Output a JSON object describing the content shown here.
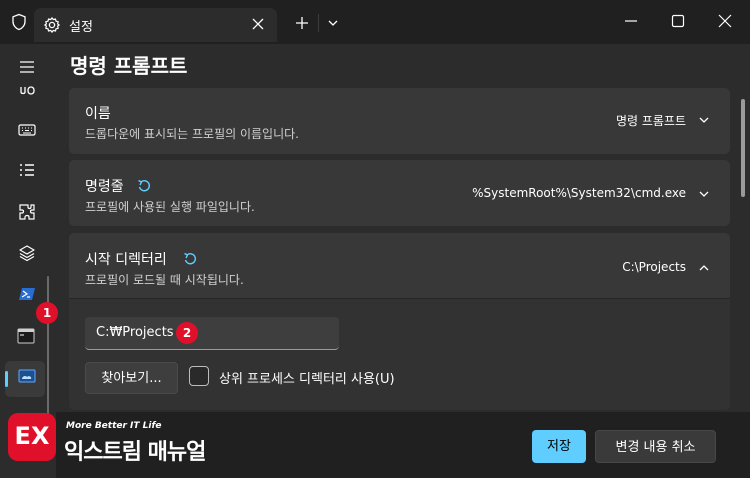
{
  "window": {
    "tab_title": "설정"
  },
  "page": {
    "title": "명령 프롬프트"
  },
  "settings": {
    "name": {
      "title": "이름",
      "desc": "드롭다운에 표시되는 프로필의 이름입니다.",
      "value": "명령 프롬프트"
    },
    "commandline": {
      "title": "명령줄",
      "desc": "프로필에 사용된 실행 파일입니다.",
      "value": "%SystemRoot%\\System32\\cmd.exe"
    },
    "start_dir": {
      "title": "시작 디렉터리",
      "desc": "프로필이 로드될 때 시작됩니다.",
      "value": "C:\\Projects",
      "input_value": "C:₩Projects",
      "browse_label": "찾아보기...",
      "checkbox_label": "상위 프로세스 디렉터리 사용(U)",
      "checkbox_checked": false
    }
  },
  "footer": {
    "save_label": "저장",
    "discard_label": "변경 내용 취소"
  },
  "badges": {
    "one": "1",
    "two": "2"
  },
  "watermark": {
    "logo": "EX",
    "tagline": "More Better IT Life",
    "name": "익스트림 매뉴얼"
  },
  "colors": {
    "accent": "#60cdff",
    "badge": "#e0102a",
    "background": "#2c2c2c",
    "card": "#383838"
  }
}
